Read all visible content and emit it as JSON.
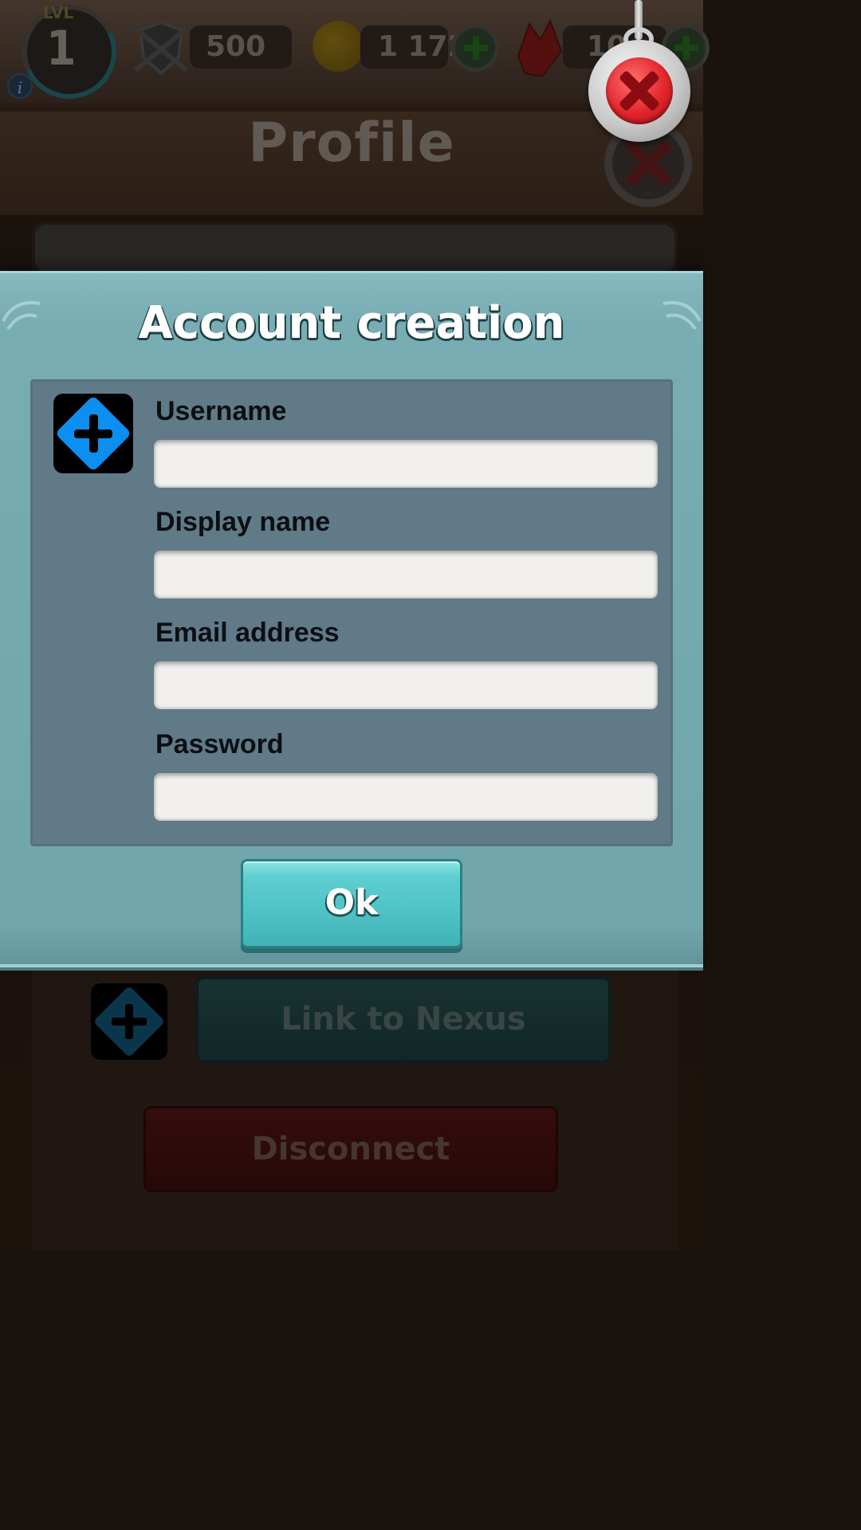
{
  "hud": {
    "level_label": "LVL",
    "level_value": "1",
    "trophies": "500",
    "coins": "1 172",
    "gems": "10"
  },
  "background": {
    "title": "Profile",
    "link_button": "Link to Nexus",
    "disconnect_button": "Disconnect"
  },
  "dialog": {
    "title": "Account creation",
    "fields": [
      {
        "label": "Username",
        "value": ""
      },
      {
        "label": "Display name",
        "value": ""
      },
      {
        "label": "Email address",
        "value": ""
      },
      {
        "label": "Password",
        "value": ""
      }
    ],
    "ok_label": "Ok"
  },
  "icons": {
    "logo": "nexus-logo-icon",
    "close": "close-icon",
    "info": "info-icon",
    "coin": "coin-icon",
    "gem": "gem-icon",
    "shield": "shield-icon",
    "add": "plus-icon"
  },
  "colors": {
    "dialog_bg": "#77adb3",
    "panel_bg": "#607a87",
    "ok_button": "#4fc3c6",
    "nexus_blue": "#0c8ff0",
    "close_red": "#e3262b"
  }
}
